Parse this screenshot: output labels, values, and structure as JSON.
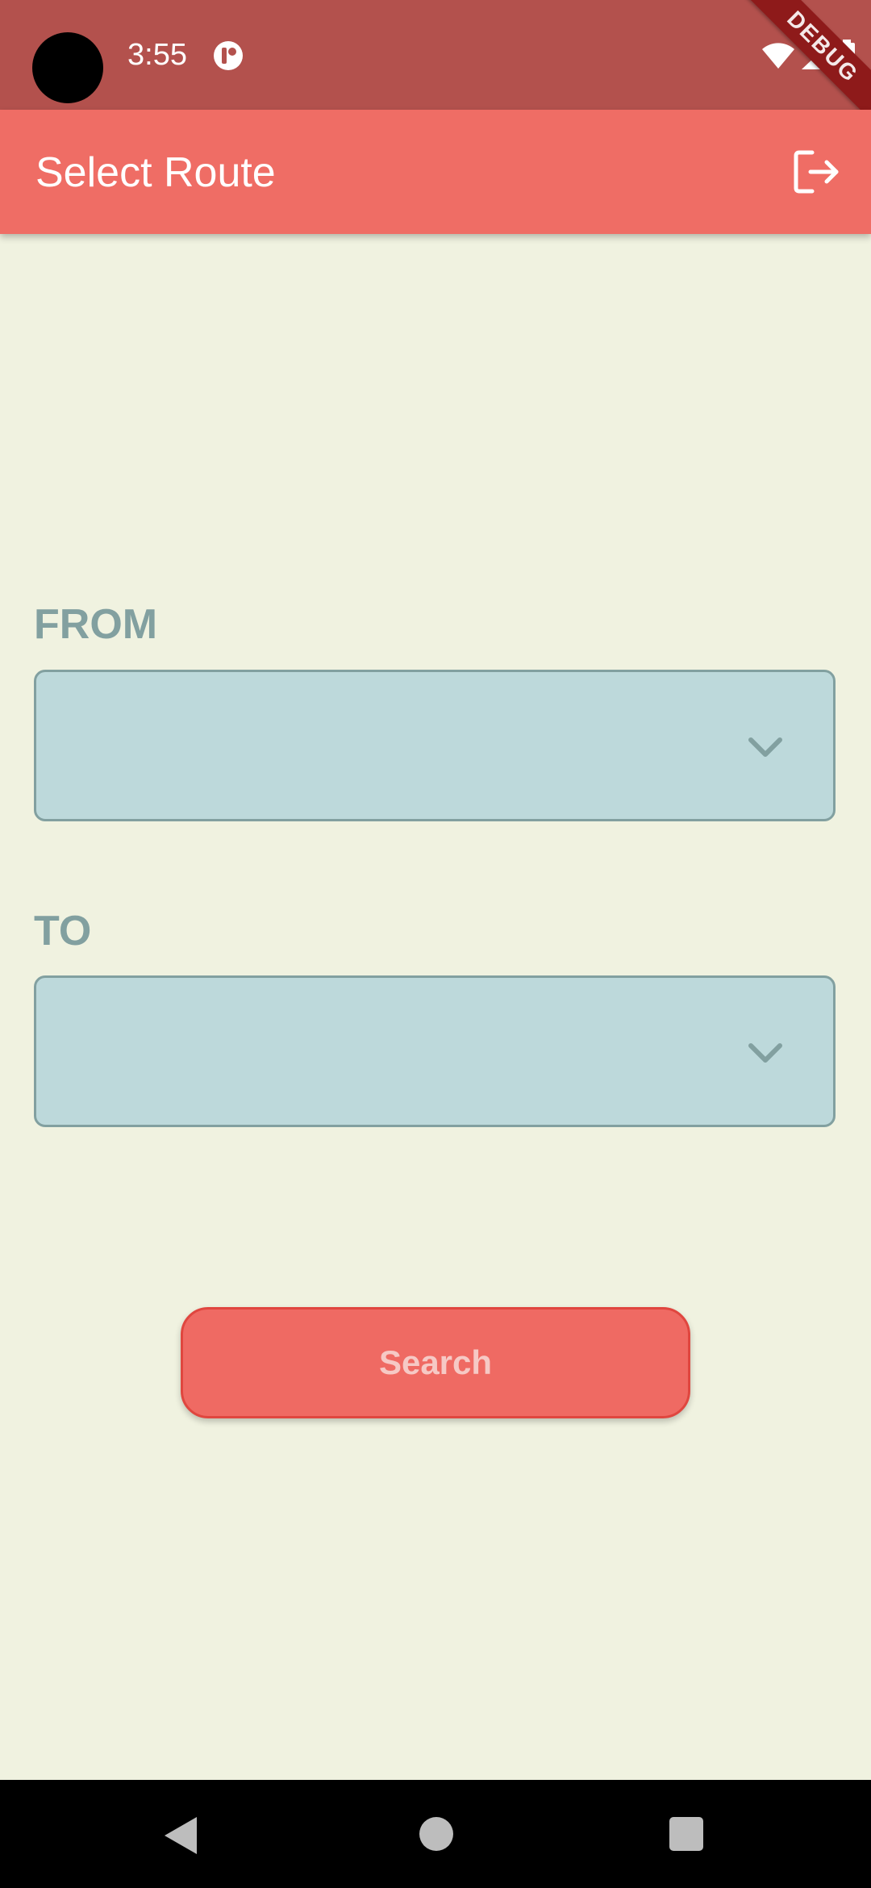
{
  "status_bar": {
    "time": "3:55",
    "icons": [
      "notification-app-icon",
      "wifi-icon",
      "signal-icon",
      "battery-icon"
    ]
  },
  "debug_banner": "DEBUG",
  "app_bar": {
    "title": "Select Route",
    "action_icon": "logout-icon"
  },
  "form": {
    "from_label": "FROM",
    "from_value": "",
    "to_label": "TO",
    "to_value": "",
    "search_label": "Search"
  },
  "nav_bar": {
    "icons": [
      "back-icon",
      "home-icon",
      "recents-icon"
    ]
  },
  "colors": {
    "status_bar": "#B3514D",
    "app_bar": "#EF6D65",
    "background": "#F0F2E0",
    "dropdown_fill": "#BDD9DB",
    "label": "#82A0A0",
    "button": "#EF6A63"
  }
}
